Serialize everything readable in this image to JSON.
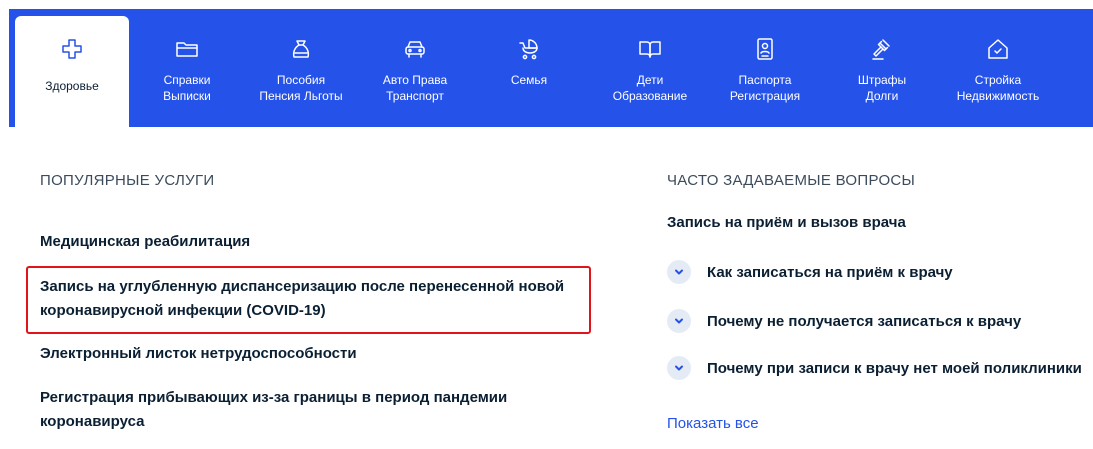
{
  "tabs": [
    {
      "icon": "medical-cross-icon",
      "label_1": "Здоровье",
      "label_2": ""
    },
    {
      "icon": "folder-icon",
      "label_1": "Справки",
      "label_2": "Выписки"
    },
    {
      "icon": "wallet-icon",
      "label_1": "Пособия",
      "label_2": "Пенсия Льготы"
    },
    {
      "icon": "car-icon",
      "label_1": "Авто Права",
      "label_2": "Транспорт"
    },
    {
      "icon": "stroller-icon",
      "label_1": "Семья",
      "label_2": ""
    },
    {
      "icon": "book-icon",
      "label_1": "Дети",
      "label_2": "Образование"
    },
    {
      "icon": "passport-icon",
      "label_1": "Паспорта",
      "label_2": "Регистрация"
    },
    {
      "icon": "gavel-icon",
      "label_1": "Штрафы",
      "label_2": "Долги"
    },
    {
      "icon": "house-icon",
      "label_1": "Стройка",
      "label_2": "Недвижимость"
    }
  ],
  "popular": {
    "title": "ПОПУЛЯРНЫЕ УСЛУГИ",
    "items": [
      {
        "line_1": "Медицинская реабилитация",
        "line_2": ""
      },
      {
        "line_1": "Запись на углубленную диспансеризацию после перенесенной новой",
        "line_2": "коронавирусной инфекции (COVID-19)"
      },
      {
        "line_1": "Электронный листок нетрудоспособности",
        "line_2": ""
      },
      {
        "line_1": "Регистрация прибывающих из-за границы в период пандемии",
        "line_2": "коронавируса"
      }
    ]
  },
  "faq": {
    "title": "ЧАСТО ЗАДАВАЕМЫЕ ВОПРОСЫ",
    "heading": "Запись на приём и вызов врача",
    "questions": [
      "Как записаться на приём к врачу",
      "Почему не получается записаться к врачу",
      "Почему при записи к врачу нет моей поликлиники"
    ],
    "show_all": "Показать все"
  },
  "colors": {
    "accent": "#2552e8",
    "highlight": "#e0151b",
    "text": "#0b1f33"
  }
}
